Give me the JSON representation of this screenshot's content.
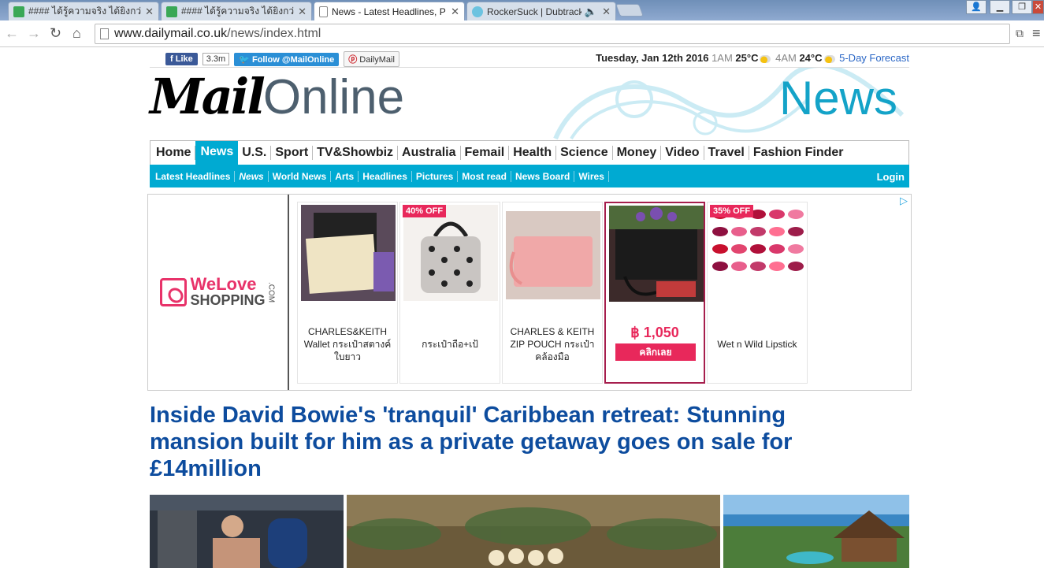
{
  "browser": {
    "tabs": [
      {
        "title": "#### ได้รู้ความจริง ได้ยิงกว่า"
      },
      {
        "title": "#### ได้รู้ความจริง ได้ยิงกว่า"
      },
      {
        "title": "News - Latest Headlines, P"
      },
      {
        "title": "RockerSuck | Dubtrack.f"
      }
    ],
    "url_host": "www.dailymail.co.uk",
    "url_path": "/news/index.html"
  },
  "social": {
    "like_label": "Like",
    "like_count": "3.3m",
    "twitter_label": "Follow @MailOnline",
    "pinterest_label": "DailyMail"
  },
  "weather": {
    "date": "Tuesday, Jan 12th 2016",
    "time1": "1AM",
    "temp1": "25°C",
    "time2": "4AM",
    "temp2": "24°C",
    "forecast_link": "5-Day Forecast"
  },
  "masthead": {
    "logo_mail": "Mail",
    "logo_online": "Online",
    "section": "News"
  },
  "nav": {
    "main": [
      "Home",
      "News",
      "U.S.",
      "Sport",
      "TV&Showbiz",
      "Australia",
      "Femail",
      "Health",
      "Science",
      "Money",
      "Video",
      "Travel",
      "Fashion Finder"
    ],
    "sub": [
      "Latest Headlines",
      "News",
      "World News",
      "Arts",
      "Headlines",
      "Pictures",
      "Most read",
      "News Board",
      "Wires"
    ],
    "login": "Login"
  },
  "ad": {
    "brand_we": "WeLove",
    "brand_shopping": "SHOPPING",
    "brand_com": ".COM",
    "products": [
      {
        "name": "CHARLES&KEITH Wallet กระเป๋าสตางค์ใบยาว",
        "badge": ""
      },
      {
        "name": "กระเป๋าถือ+เป้",
        "badge": "40% OFF"
      },
      {
        "name": "CHARLES & KEITH ZIP POUCH กระเป๋าคล้องมือ",
        "badge": ""
      },
      {
        "name": "",
        "badge": "",
        "price": "฿ 1,050",
        "cta": "คลิกเลย"
      },
      {
        "name": "Wet n Wild Lipstick",
        "badge": "35% OFF"
      }
    ]
  },
  "article": {
    "headline": "Inside David Bowie's 'tranquil' Caribbean retreat: Stunning mansion built for him as a private getaway goes on sale for £14million"
  }
}
